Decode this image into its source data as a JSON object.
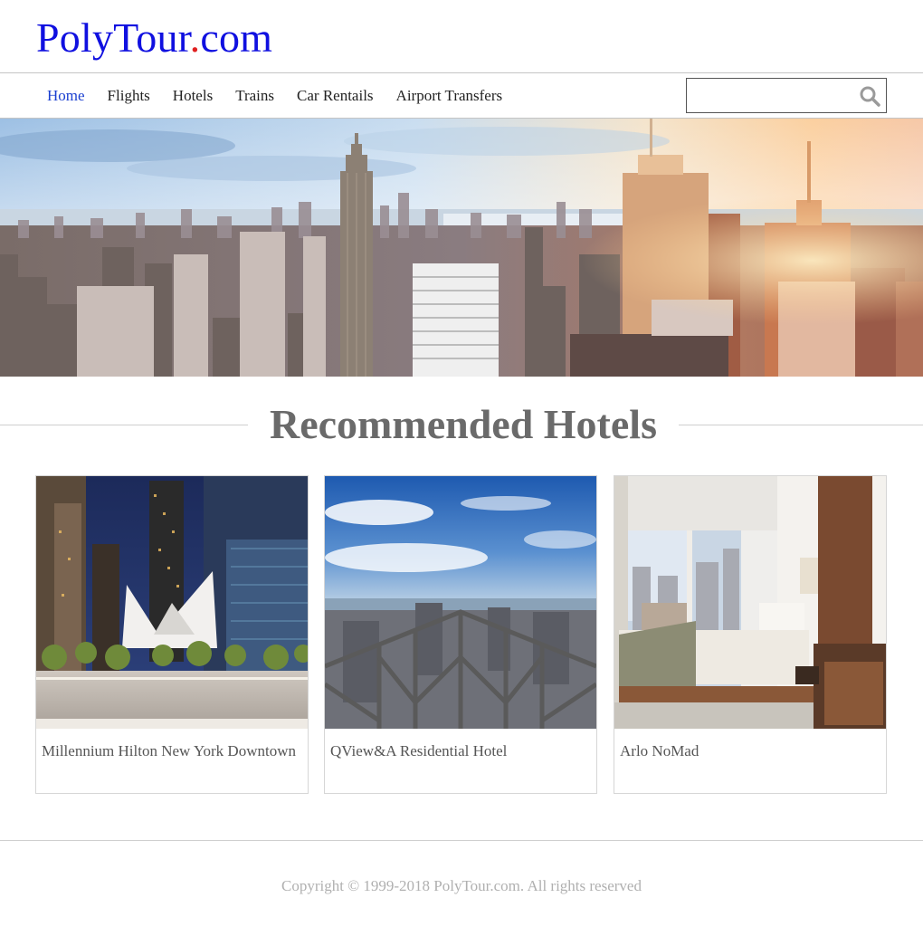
{
  "header": {
    "logo_main": "PolyTour",
    "logo_dot": ".",
    "logo_tld": "com"
  },
  "nav": {
    "items": [
      {
        "label": "Home",
        "active": true
      },
      {
        "label": "Flights",
        "active": false
      },
      {
        "label": "Hotels",
        "active": false
      },
      {
        "label": "Trains",
        "active": false
      },
      {
        "label": "Car Rentails",
        "active": false
      },
      {
        "label": "Airport Transfers",
        "active": false
      }
    ],
    "search": {
      "value": "",
      "placeholder": "",
      "icon": "search-icon"
    }
  },
  "hero": {
    "image": "new-york-city-skyline-photo"
  },
  "recommended": {
    "title": "Recommended Hotels",
    "hotels": [
      {
        "name": "Millennium Hilton New York Downtown",
        "image": "world-trade-center-oculus-night-photo"
      },
      {
        "name": "QView&A Residential Hotel",
        "image": "observation-deck-city-view-photo"
      },
      {
        "name": "Arlo NoMad",
        "image": "hotel-room-bed-window-photo"
      }
    ]
  },
  "footer": {
    "copyright": "Copyright © 1999-2018 PolyTour.com. All rights reserved"
  },
  "colors": {
    "logo_blue": "#1010e0",
    "logo_dot_red": "#e02020",
    "nav_active": "#1a3fd0",
    "heading_gray": "#6a6a6a"
  }
}
